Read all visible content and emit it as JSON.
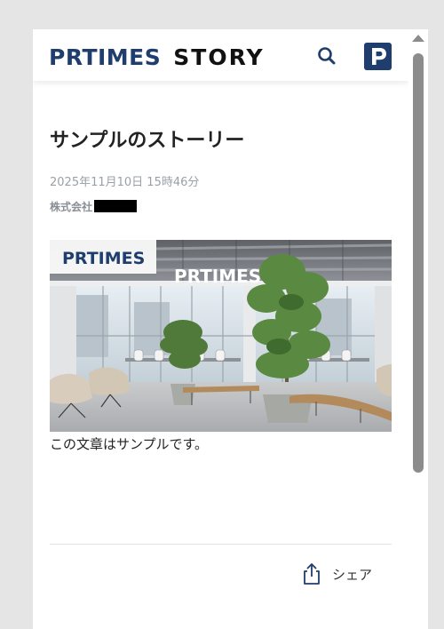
{
  "header": {
    "logo_prtimes": "PRTIMES",
    "logo_story": "STORY",
    "icons": {
      "search": "search-icon",
      "p_app": "prtimes-p-icon"
    },
    "colors": {
      "brand": "#1f3d6d",
      "text": "#111111"
    }
  },
  "article": {
    "title": "サンプルのストーリー",
    "date": "2025年11月10日 15時46分",
    "company": "株式会社",
    "hero_logo_overlay": "PRTIMES",
    "hero_logo_wall": "PRTIMES",
    "body": "この文章はサンプルです。"
  },
  "footer": {
    "share_label": "シェア",
    "icons": {
      "share": "share-icon"
    }
  }
}
